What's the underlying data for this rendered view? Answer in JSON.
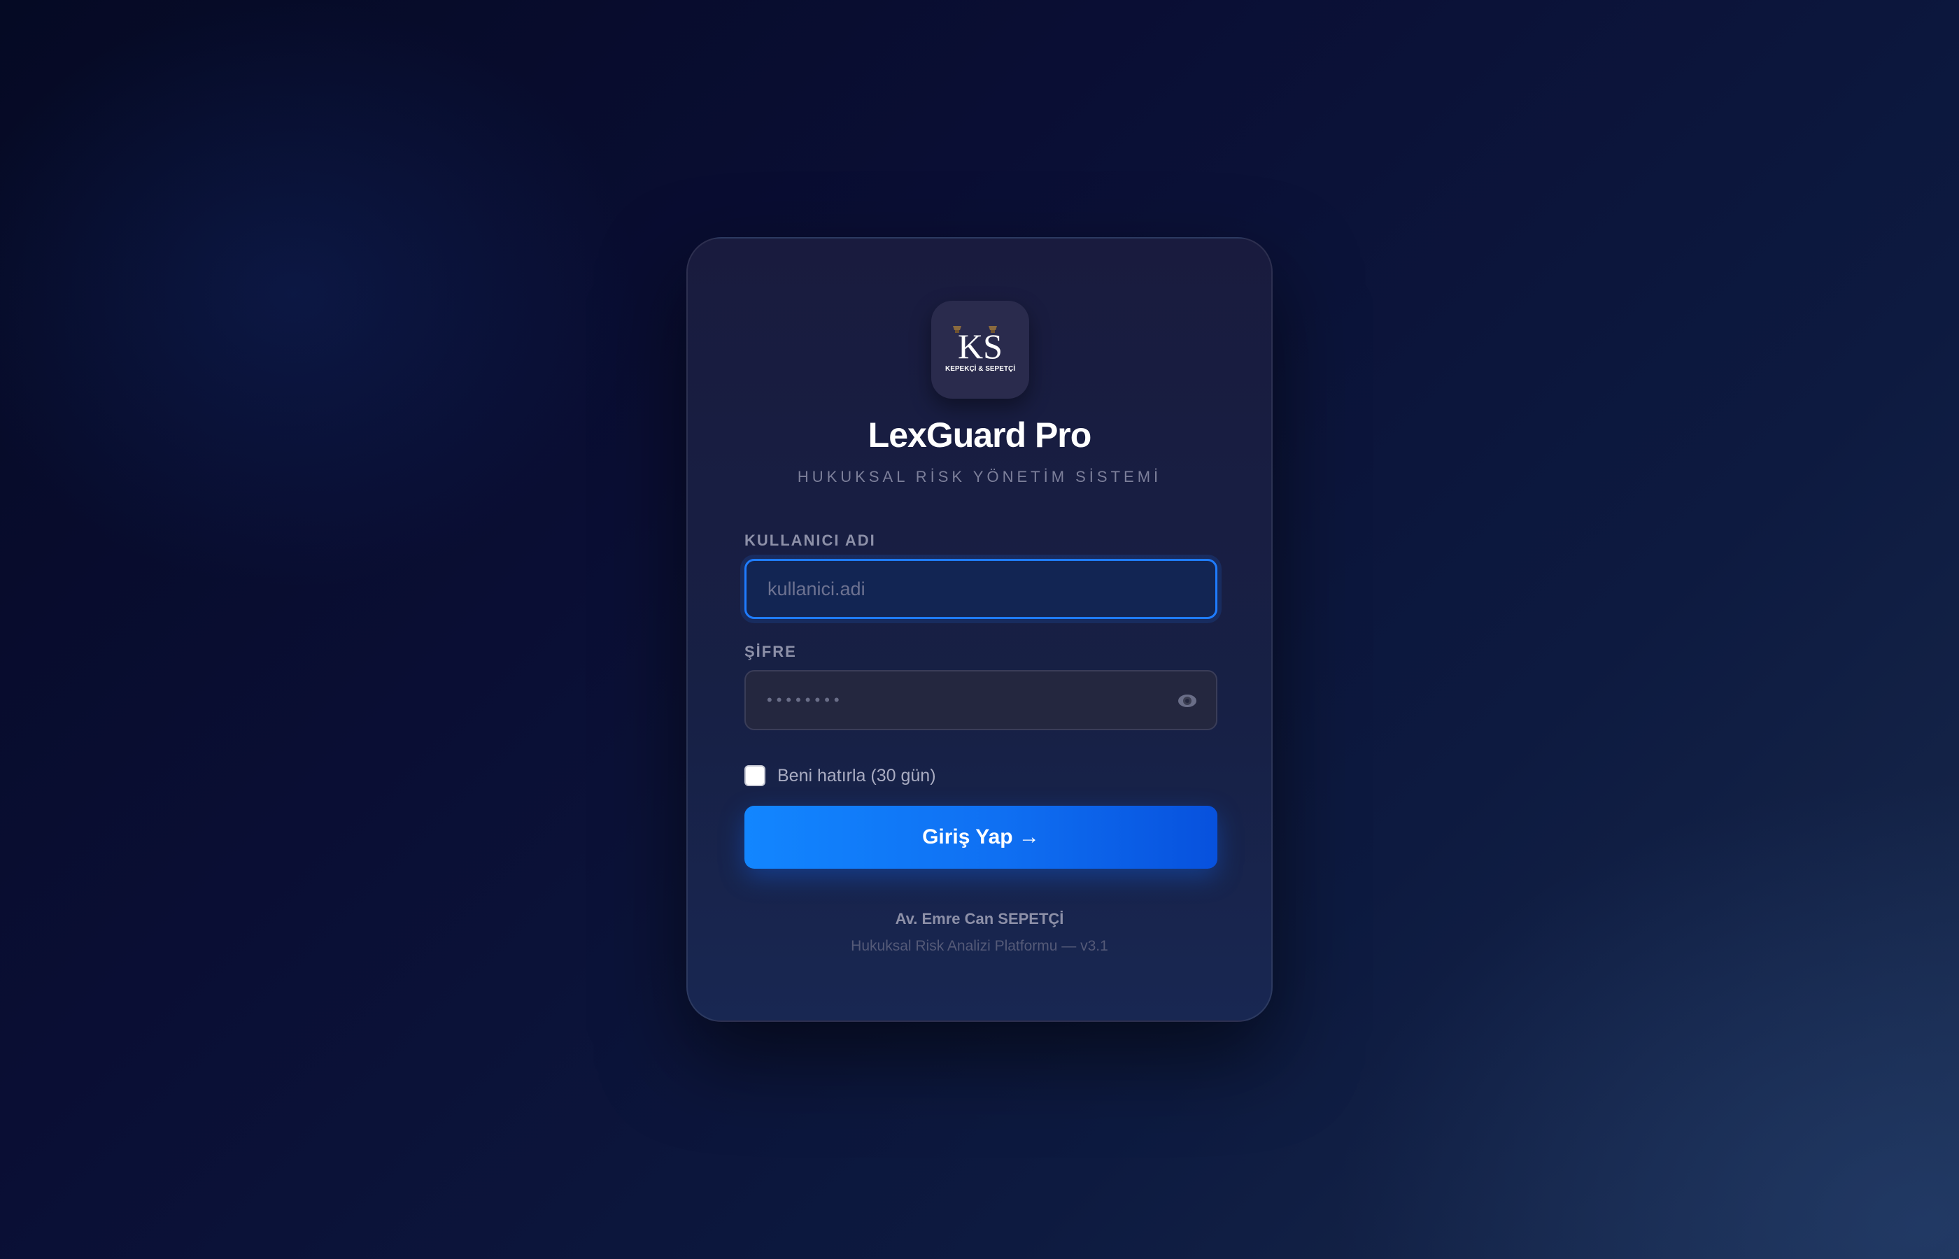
{
  "app": {
    "title": "LexGuard Pro",
    "subtitle": "HUKUKSAL RİSK YÖNETİM SİSTEMİ",
    "logo_text": "KS",
    "logo_caption": "KEPEKÇİ & SEPETÇİ"
  },
  "form": {
    "username_label": "KULLANICI ADI",
    "username_placeholder": "kullanici.adi",
    "username_value": "",
    "password_label": "ŞİFRE",
    "password_placeholder": "••••••••",
    "password_value": "",
    "show_password_icon": "eye-icon",
    "remember_label": "Beni hatırla (30 gün)",
    "remember_checked": false,
    "submit_label": "Giriş Yap →"
  },
  "footer": {
    "author": "Av. Emre Can SEPETÇİ",
    "platform": "Hukuksal Risk Analizi Platformu — v3.1"
  },
  "colors": {
    "accent": "#1286ff",
    "background": "#0a0e34",
    "card": "#191b3e"
  }
}
